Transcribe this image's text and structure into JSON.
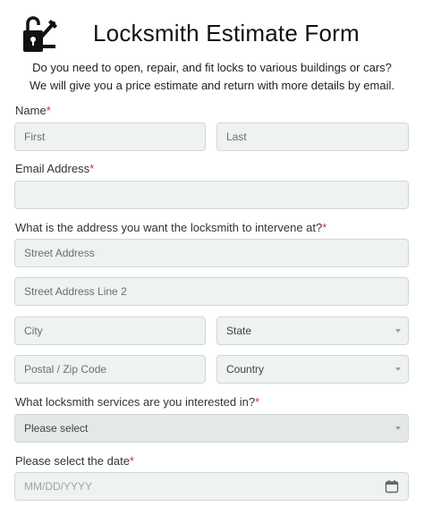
{
  "header": {
    "title": "Locksmith Estimate Form",
    "description_line1": "Do you need to open, repair, and fit locks to various buildings or cars?",
    "description_line2": "We will give you a price estimate and return with more details by email."
  },
  "name": {
    "label": "Name",
    "required_mark": "*",
    "first_placeholder": "First",
    "last_placeholder": "Last"
  },
  "email": {
    "label": "Email Address",
    "required_mark": "*",
    "placeholder": ""
  },
  "address": {
    "label": "What is the address you want the locksmith to intervene at?",
    "required_mark": "*",
    "street_placeholder": "Street Address",
    "street2_placeholder": "Street Address Line 2",
    "city_placeholder": "City",
    "state_value": "State",
    "zip_placeholder": "Postal / Zip Code",
    "country_value": "Country"
  },
  "services": {
    "label": "What locksmith services are you interested in?",
    "required_mark": "*",
    "selected": "Please select"
  },
  "date": {
    "label": "Please select the date",
    "required_mark": "*",
    "placeholder": "MM/DD/YYYY"
  },
  "colors": {
    "field_bg": "#eef2f0",
    "field_border": "#cfd8d4",
    "required": "#d93025"
  },
  "icons": [
    "padlock-key-logo",
    "chevron-down-icon",
    "calendar-icon"
  ]
}
